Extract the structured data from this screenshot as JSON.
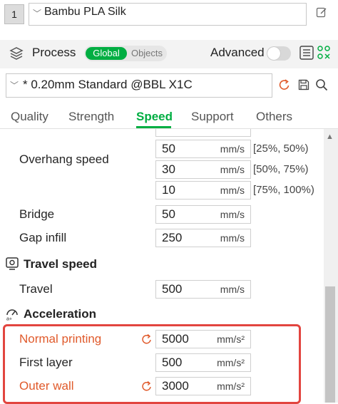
{
  "filament": {
    "index": "1",
    "name": "Bambu PLA Silk"
  },
  "process": {
    "title": "Process",
    "toggle": {
      "global": "Global",
      "objects": "Objects"
    },
    "advanced_label": "Advanced"
  },
  "preset": {
    "name": "* 0.20mm Standard @BBL X1C"
  },
  "tabs": [
    "Quality",
    "Strength",
    "Speed",
    "Support",
    "Others"
  ],
  "active_tab": "Speed",
  "speed": {
    "partial_row": {
      "value": "",
      "unit": "",
      "range": ""
    },
    "overhang": {
      "label": "Overhang speed",
      "rows": [
        {
          "value": "50",
          "unit": "mm/s",
          "range": "[25%, 50%)"
        },
        {
          "value": "30",
          "unit": "mm/s",
          "range": "[50%, 75%)"
        },
        {
          "value": "10",
          "unit": "mm/s",
          "range": "[75%, 100%)"
        }
      ]
    },
    "bridge": {
      "label": "Bridge",
      "value": "50",
      "unit": "mm/s"
    },
    "gap_infill": {
      "label": "Gap infill",
      "value": "250",
      "unit": "mm/s"
    }
  },
  "travel_speed": {
    "title": "Travel speed",
    "travel": {
      "label": "Travel",
      "value": "500",
      "unit": "mm/s"
    }
  },
  "acceleration": {
    "title": "Acceleration",
    "normal_printing": {
      "label": "Normal printing",
      "value": "5000",
      "unit": "mm/s²",
      "modified": true
    },
    "first_layer": {
      "label": "First layer",
      "value": "500",
      "unit": "mm/s²",
      "modified": false
    },
    "outer_wall": {
      "label": "Outer wall",
      "value": "3000",
      "unit": "mm/s²",
      "modified": true
    }
  },
  "colors": {
    "accent": "#00ae42",
    "modified": "#e05a2b",
    "highlight": "#e2453f"
  }
}
